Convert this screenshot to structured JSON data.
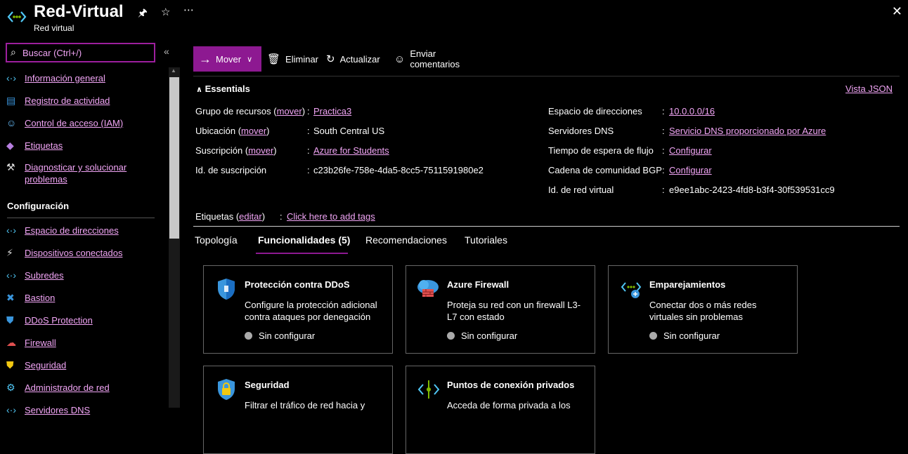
{
  "header": {
    "title": "Red-Virtual",
    "subtitle": "Red virtual",
    "pin_icon": "pin-icon",
    "star_icon": "star-icon",
    "more_icon": "ellipsis-icon",
    "close_icon": "close-icon"
  },
  "sidebar": {
    "search_placeholder": "Buscar (Ctrl+/)",
    "items": [
      {
        "icon": "vnet-icon",
        "label": "Información general"
      },
      {
        "icon": "activity-log-icon",
        "label": "Registro de actividad"
      },
      {
        "icon": "iam-icon",
        "label": "Control de acceso (IAM)"
      },
      {
        "icon": "tag-icon",
        "label": "Etiquetas"
      },
      {
        "icon": "wrench-icon",
        "label": "Diagnosticar y solucionar problemas"
      }
    ],
    "section_title": "Configuración",
    "config_items": [
      {
        "icon": "address-space-icon",
        "label": "Espacio de direcciones"
      },
      {
        "icon": "plug-icon",
        "label": "Dispositivos conectados"
      },
      {
        "icon": "subnet-icon",
        "label": "Subredes"
      },
      {
        "icon": "bastion-icon",
        "label": "Bastion"
      },
      {
        "icon": "ddos-shield-icon",
        "label": "DDoS Protection"
      },
      {
        "icon": "firewall-icon",
        "label": "Firewall"
      },
      {
        "icon": "security-icon",
        "label": "Seguridad"
      },
      {
        "icon": "network-manager-icon",
        "label": "Administrador de red"
      },
      {
        "icon": "dns-icon",
        "label": "Servidores DNS"
      }
    ]
  },
  "toolbar": {
    "move": "Mover",
    "delete": "Eliminar",
    "refresh": "Actualizar",
    "feedback": "Enviar comentarios"
  },
  "essentials": {
    "title": "Essentials",
    "json_view": "Vista JSON",
    "left": [
      {
        "label": "Grupo de recursos",
        "paren_link": "mover",
        "value": "Practica3",
        "value_is_link": true
      },
      {
        "label": "Ubicación",
        "paren_link": "mover",
        "value": "South Central US",
        "value_is_link": false
      },
      {
        "label": "Suscripción",
        "paren_link": "mover",
        "value": "Azure for Students",
        "value_is_link": true
      },
      {
        "label": "Id. de suscripción",
        "paren_link": "",
        "value": "c23b26fe-758e-4da5-8cc5-7511591980e2",
        "value_is_link": false
      }
    ],
    "right": [
      {
        "label": "Espacio de direcciones",
        "value": "10.0.0.0/16",
        "value_is_link": true
      },
      {
        "label": "Servidores DNS",
        "value": "Servicio DNS proporcionado por Azure",
        "value_is_link": true
      },
      {
        "label": "Tiempo de espera de flujo",
        "value": "Configurar",
        "value_is_link": true
      },
      {
        "label": "Cadena de comunidad BGP",
        "value": "Configurar",
        "value_is_link": true
      },
      {
        "label": "Id. de red virtual",
        "value": "e9ee1abc-2423-4fd8-b3f4-30f539531cc9",
        "value_is_link": false
      }
    ],
    "tags_label": "Etiquetas",
    "tags_edit": "editar",
    "tags_value": "Click here to add tags"
  },
  "tabs": [
    {
      "label": "Topología",
      "active": false
    },
    {
      "label": "Funcionalidades (5)",
      "active": true
    },
    {
      "label": "Recomendaciones",
      "active": false
    },
    {
      "label": "Tutoriales",
      "active": false
    }
  ],
  "cards": [
    {
      "icon": "ddos-shield-icon",
      "title": "Protección contra DDoS",
      "desc": "Configure la protección adicional contra ataques por denegación",
      "status": "Sin configurar"
    },
    {
      "icon": "firewall-cloud-icon",
      "title": "Azure Firewall",
      "desc": "Proteja su red con un firewall L3-L7 con estado",
      "status": "Sin configurar"
    },
    {
      "icon": "peering-icon",
      "title": "Emparejamientos",
      "desc": "Conectar dos o más redes virtuales sin problemas",
      "status": "Sin configurar"
    },
    {
      "icon": "security-lock-icon",
      "title": "Seguridad",
      "desc": "Filtrar el tráfico de red hacia y",
      "status": ""
    },
    {
      "icon": "private-endpoint-icon",
      "title": "Puntos de conexión privados",
      "desc": "Acceda de forma privada a los",
      "status": ""
    }
  ],
  "colors": {
    "accent": "#8d1991",
    "link": "#f1a5f5",
    "background": "#000000"
  }
}
